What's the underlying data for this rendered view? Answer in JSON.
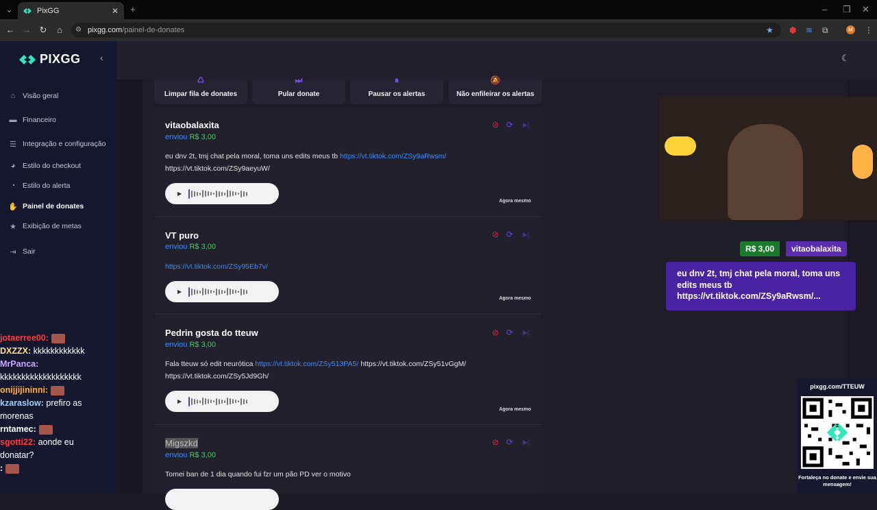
{
  "browser": {
    "tab_title": "PixGG",
    "url_host": "pixgg.com",
    "url_path": "/painel-de-donates",
    "profile_initial": "M"
  },
  "sidebar": {
    "brand": "PIXGG",
    "items": [
      {
        "label": "Visão geral",
        "icon": "home-icon"
      },
      {
        "label": "Financeiro",
        "icon": "wallet-icon"
      },
      {
        "label": "Integração e configuração",
        "icon": "settings-icon"
      },
      {
        "label": "Estilo do checkout",
        "icon": "palette-icon"
      },
      {
        "label": "Estilo do alerta",
        "icon": "alert-style-icon"
      },
      {
        "label": "Painel de donates",
        "icon": "donate-icon"
      },
      {
        "label": "Exibição de metas",
        "icon": "star-icon"
      },
      {
        "label": "Sair",
        "icon": "logout-icon"
      }
    ],
    "active_index": 5
  },
  "actions": [
    {
      "label": "Limpar fila de donates",
      "icon": "clear-queue-icon"
    },
    {
      "label": "Pular donate",
      "icon": "skip-icon"
    },
    {
      "label": "Pausar os alertas",
      "icon": "pause-icon"
    },
    {
      "label": "Não enfileirar os alertas",
      "icon": "no-queue-icon"
    }
  ],
  "donates": [
    {
      "name": "vitaobalaxita",
      "sent_label": "enviou",
      "amount": "R$ 3,00",
      "message_parts": [
        {
          "text": "eu dnv 2t, tmj chat pela moral, toma uns edits meus tb ",
          "link": false
        },
        {
          "text": "https://vt.tiktok.com/ZSy9aRwsm/",
          "link": true
        },
        {
          "text": " https://vt.tiktok.com/ZSy9aeyuW/",
          "link": false
        }
      ],
      "time": "Agora mesmo"
    },
    {
      "name": "VT puro",
      "sent_label": "enviou",
      "amount": "R$ 3,00",
      "message_parts": [
        {
          "text": "https://vt.tiktok.com/ZSy95Eb7v/",
          "link": true
        }
      ],
      "time": "Agora mesmo"
    },
    {
      "name": "Pedrin gosta do tteuw",
      "sent_label": "enviou",
      "amount": "R$ 3,00",
      "message_parts": [
        {
          "text": "Fala tteuw só edit neurótica ",
          "link": false
        },
        {
          "text": "https://vt.tiktok.com/ZSy513PA5/",
          "link": true
        },
        {
          "text": " https://vt.tiktok.com/ZSy51vGgM/ https://vt.tiktok.com/ZSy5Jd9Gh/",
          "link": false
        }
      ],
      "time": "Agora mesmo"
    },
    {
      "name": "Migszkd",
      "sent_label": "enviou",
      "amount": "R$ 3,00",
      "message_parts": [
        {
          "text": "Tomei ban de 1 dia quando fui fzr um pão PD ver o motivo",
          "link": false
        }
      ],
      "time": ""
    }
  ],
  "overlay": {
    "amount": "R$ 3,00",
    "donor": "vitaobalaxita",
    "message": "eu dnv 2t, tmj chat pela moral, toma uns edits meus tb https://vt.tiktok.com/ZSy9aRwsm/...",
    "qr_url": "pixgg.com/TTEUW",
    "qr_caption": "Fortaleça no donate e envie sua mensagem!"
  },
  "chat": [
    {
      "user": "jotaerree00:",
      "color": "#ff3b3b",
      "message": "",
      "emote": true
    },
    {
      "user": "DXZZX:",
      "color": "#ffe08a",
      "message": "kkkkkkkkkkkk",
      "emote": false
    },
    {
      "user": "MrPanca:",
      "color": "#c9a6ff",
      "message": "",
      "emote": false
    },
    {
      "user": "",
      "color": "#ffffff",
      "message": "kkkkkkkkkkkkkkkkkkk",
      "emote": false
    },
    {
      "user": "onijjijininni:",
      "color": "#ffb13b",
      "message": "",
      "emote": true
    },
    {
      "user": "kzaraslow:",
      "color": "#9bd0ff",
      "message": "prefiro as",
      "emote": false
    },
    {
      "user": "",
      "color": "#ffffff",
      "message": "morenas",
      "emote": false
    },
    {
      "user": "rntamec:",
      "color": "#ffffff",
      "message": "",
      "emote": true
    },
    {
      "user": "sgotti22:",
      "color": "#ff3b3b",
      "message": "aonde eu",
      "emote": false
    },
    {
      "user": "",
      "color": "#ffffff",
      "message": "donatar?",
      "emote": false
    },
    {
      "user": ":",
      "color": "#ffffff",
      "message": "",
      "emote": true
    }
  ]
}
